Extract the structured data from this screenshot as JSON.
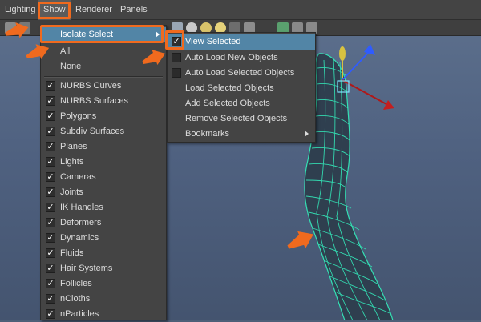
{
  "menubar": {
    "items": [
      {
        "label": "Lighting"
      },
      {
        "label": "Show"
      },
      {
        "label": "Renderer"
      },
      {
        "label": "Panels"
      }
    ]
  },
  "show_menu": {
    "isolate_select": "Isolate Select",
    "all": "All",
    "none": "None",
    "items": [
      {
        "label": "NURBS Curves",
        "checked": true
      },
      {
        "label": "NURBS Surfaces",
        "checked": true
      },
      {
        "label": "Polygons",
        "checked": true
      },
      {
        "label": "Subdiv Surfaces",
        "checked": true
      },
      {
        "label": "Planes",
        "checked": true
      },
      {
        "label": "Lights",
        "checked": true
      },
      {
        "label": "Cameras",
        "checked": true
      },
      {
        "label": "Joints",
        "checked": true
      },
      {
        "label": "IK Handles",
        "checked": true
      },
      {
        "label": "Deformers",
        "checked": true
      },
      {
        "label": "Dynamics",
        "checked": true
      },
      {
        "label": "Fluids",
        "checked": true
      },
      {
        "label": "Hair Systems",
        "checked": true
      },
      {
        "label": "Follicles",
        "checked": true
      },
      {
        "label": "nCloths",
        "checked": true
      },
      {
        "label": "nParticles",
        "checked": true
      }
    ]
  },
  "isolate_submenu": {
    "view_selected": "View Selected",
    "view_selected_checked": true,
    "auto_load_new": "Auto Load New Objects",
    "auto_load_selected": "Auto Load Selected Objects",
    "load_selected": "Load Selected Objects",
    "add_selected": "Add Selected Objects",
    "remove_selected": "Remove Selected Objects",
    "bookmarks": "Bookmarks"
  },
  "colors": {
    "highlight": "#5285a6",
    "callout": "#f06a1e",
    "mesh": "#34e0b4"
  }
}
